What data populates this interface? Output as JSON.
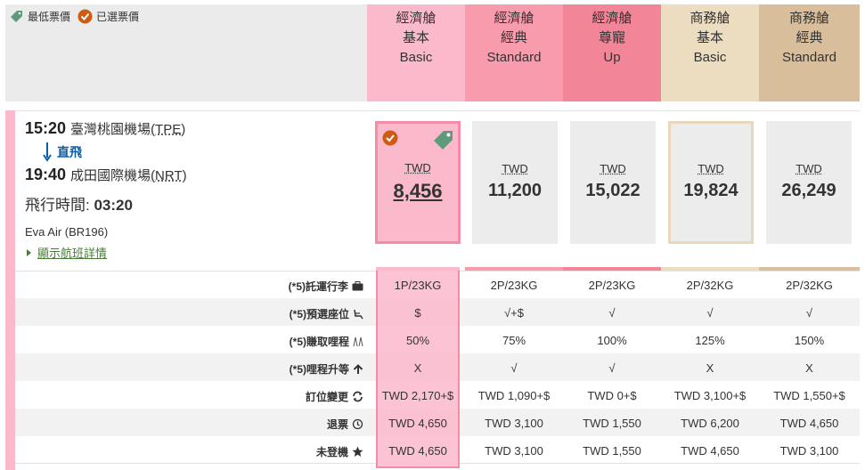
{
  "legend": {
    "lowest_label": "最低票價",
    "selected_label": "已選票價"
  },
  "fare_columns": [
    {
      "line1": "經濟艙",
      "line2": "基本",
      "line3": "Basic",
      "color": "#fbb9cc"
    },
    {
      "line1": "經濟艙",
      "line2": "經典",
      "line3": "Standard",
      "color": "#f89bac"
    },
    {
      "line1": "經濟艙",
      "line2": "尊寵",
      "line3": "Up",
      "color": "#f28597"
    },
    {
      "line1": "商務艙",
      "line2": "基本",
      "line3": "Basic",
      "color": "#ecdcc0"
    },
    {
      "line1": "商務艙",
      "line2": "經典",
      "line3": "Standard",
      "color": "#d9be9c"
    }
  ],
  "flight": {
    "dep_time": "15:20",
    "dep_airport": "臺灣桃園機場",
    "dep_code": "(TPE)",
    "direct_label": "直飛",
    "arr_time": "19:40",
    "arr_airport": "成田國際機場",
    "arr_code": "(NRT)",
    "duration_label": "飛行時間:",
    "duration": "03:20",
    "carrier": "Eva Air (BR196)",
    "details_link": "顯示航班詳情"
  },
  "prices": [
    {
      "currency": "TWD",
      "amount": "8,456"
    },
    {
      "currency": "TWD",
      "amount": "11,200"
    },
    {
      "currency": "TWD",
      "amount": "15,022"
    },
    {
      "currency": "TWD",
      "amount": "19,824"
    },
    {
      "currency": "TWD",
      "amount": "26,249"
    }
  ],
  "rows": [
    {
      "label": "(*5)託運行李",
      "icon": "luggage-icon",
      "values": [
        "1P/23KG",
        "2P/23KG",
        "2P/23KG",
        "2P/32KG",
        "2P/32KG"
      ]
    },
    {
      "label": "(*5)預選座位",
      "icon": "seat-icon",
      "values": [
        "$",
        "√+$",
        "√",
        "√",
        "√"
      ]
    },
    {
      "label": "(*5)賺取哩程",
      "icon": "miles-icon",
      "values": [
        "50%",
        "75%",
        "100%",
        "125%",
        "150%"
      ]
    },
    {
      "label": "(*5)哩程升等",
      "icon": "upgrade-arrow-icon",
      "values": [
        "X",
        "√",
        "√",
        "X",
        "X"
      ]
    },
    {
      "label": "訂位變更",
      "icon": "change-icon",
      "values": [
        "TWD 2,170+$",
        "TWD 1,090+$",
        "TWD 0+$",
        "TWD 3,100+$",
        "TWD 1,550+$"
      ]
    },
    {
      "label": "退票",
      "icon": "refund-icon",
      "values": [
        "TWD 4,650",
        "TWD 3,100",
        "TWD 1,550",
        "TWD 6,200",
        "TWD 4,650"
      ]
    },
    {
      "label": "未登機",
      "icon": "star-icon",
      "values": [
        "TWD 4,650",
        "TWD 3,100",
        "TWD 1,550",
        "TWD 4,650",
        "TWD 3,100"
      ]
    }
  ]
}
